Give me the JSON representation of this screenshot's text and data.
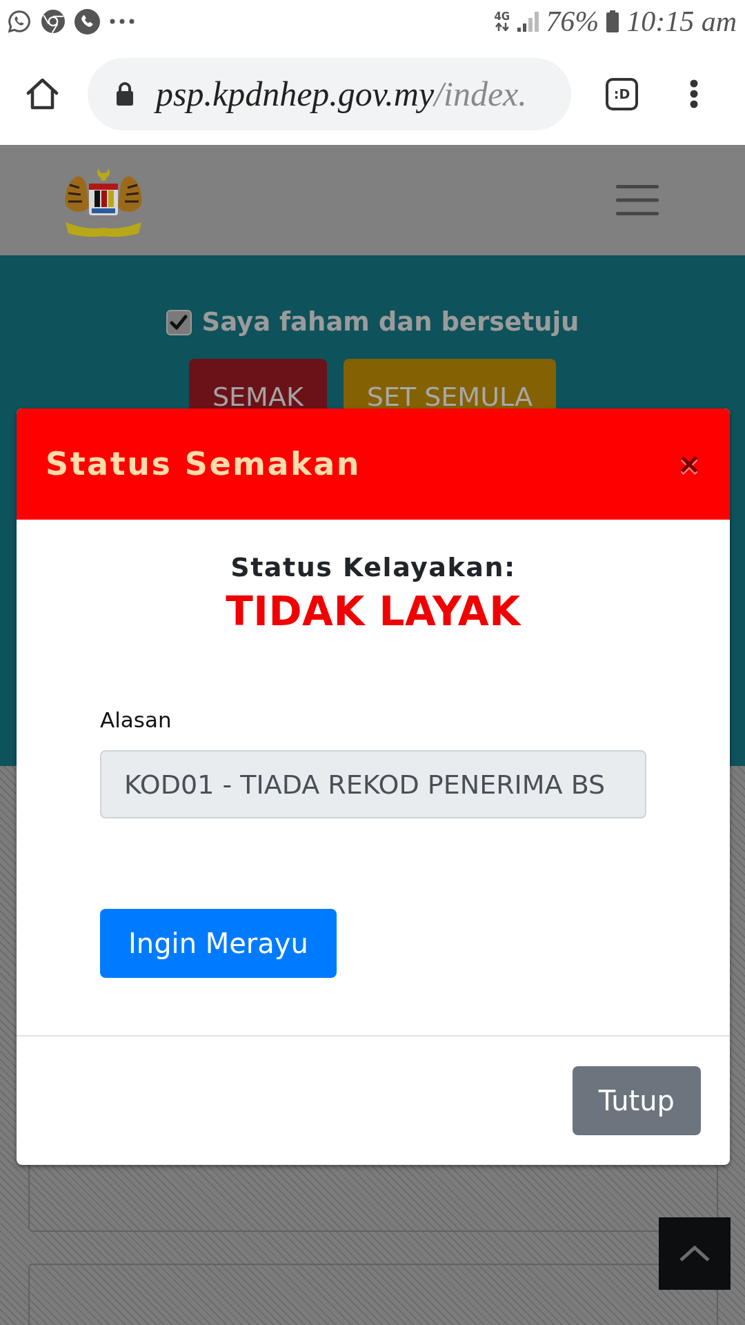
{
  "status_bar": {
    "network": "4G",
    "battery": "76%",
    "time": "10:15 am"
  },
  "browser": {
    "url_host": "psp.kpdnhep.gov.my",
    "url_path": "/index.",
    "tab_switcher": ":D"
  },
  "page": {
    "agreement": {
      "label": "Saya faham dan bersetuju",
      "checked": true
    },
    "buttons": [
      {
        "label": "SEMAK",
        "kind": "danger"
      },
      {
        "label": "SET SEMULA",
        "kind": "warning"
      }
    ]
  },
  "modal": {
    "title": "Status Semakan",
    "close": "×",
    "heading": "Status Kelayakan:",
    "result": "TIDAK LAYAK",
    "field": {
      "label": "Alasan",
      "value": "KOD01 - TIADA REKOD PENERIMA BS"
    },
    "action": {
      "label": "Ingin Merayu",
      "kind": "primary"
    },
    "footer": {
      "label": "Tutup",
      "kind": "secondary"
    }
  }
}
